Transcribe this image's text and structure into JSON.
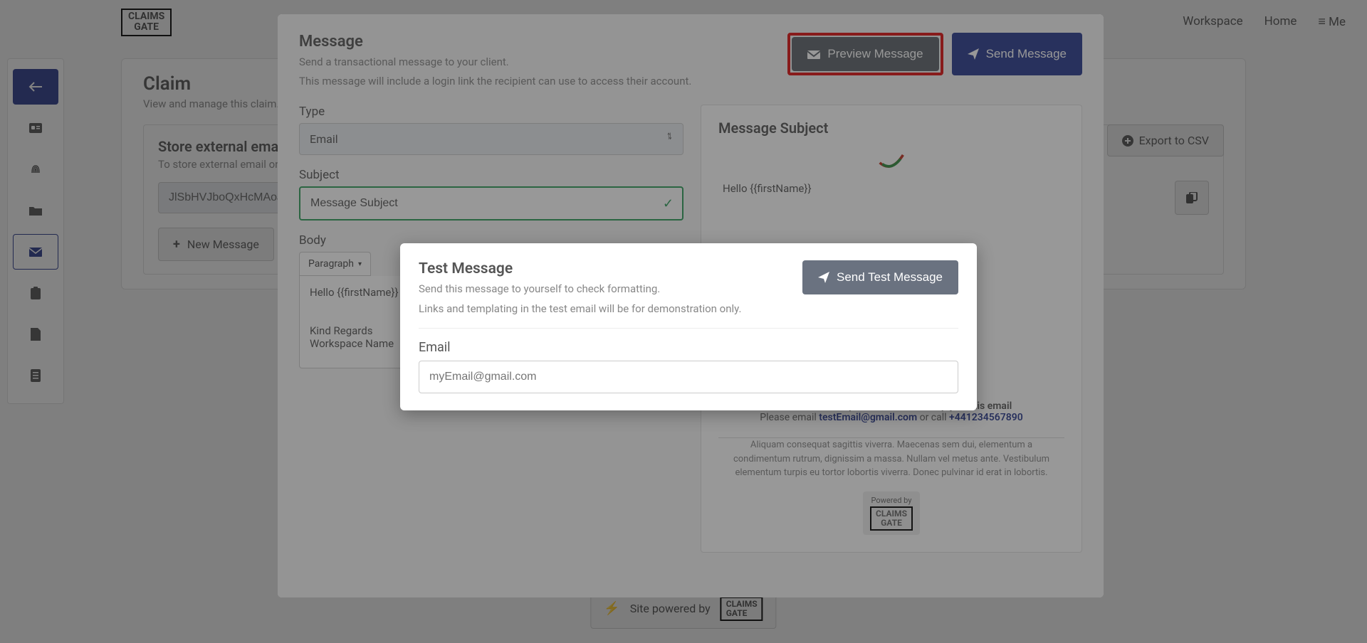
{
  "brand": {
    "line1": "CLAIMS",
    "line2": "GATE"
  },
  "topnav": {
    "workspace": "Workspace",
    "home": "Home",
    "me": "Me"
  },
  "claim": {
    "title": "Claim",
    "subtitle": "View and manage this claim.",
    "export_label": "Export to CSV"
  },
  "external_email": {
    "title": "Store external email",
    "subtitle": "To store external email on this ...",
    "value": "JlSbHVJboQxHcMAoJT",
    "new_message_label": "New Message"
  },
  "footer": {
    "powered_by": "Site powered by"
  },
  "message_modal": {
    "title": "Message",
    "sub1": "Send a transactional message to your client.",
    "sub2": "This message will include a login link the recipient can use to access their account.",
    "preview_label": "Preview Message",
    "send_label": "Send Message",
    "type_label": "Type",
    "type_value": "Email",
    "subject_label": "Subject",
    "subject_value": "Message Subject",
    "body_label": "Body",
    "paragraph_label": "Paragraph",
    "editor_hello": "Hello {{firstName}}",
    "editor_regards": "Kind Regards",
    "editor_workspace": "Workspace Name"
  },
  "preview": {
    "subject_heading": "Message Subject",
    "hello": "Hello {{firstName}}",
    "contact_prefix": "To contact Workspace Name do not reply to this email",
    "please_email": "Please email ",
    "email_addr": "testEmail@gmail.com",
    "or_call": " or call ",
    "phone": "+441234567890",
    "lorem": "Aliquam consequat sagittis viverra. Maecenas sem dui, elementum a condimentum rutrum, dignissim a massa. Nullam vel metus ante. Vestibulum elementum turpis eu tortor lobortis viverra. Donec pulvinar id erat in lobortis.",
    "powered_by": "Powered by"
  },
  "test_popup": {
    "title": "Test Message",
    "sub1": "Send this message to yourself to check formatting.",
    "sub2": "Links and templating in the test email will be for demonstration only.",
    "send_label": "Send Test Message",
    "email_label": "Email",
    "email_placeholder": "myEmail@gmail.com"
  }
}
